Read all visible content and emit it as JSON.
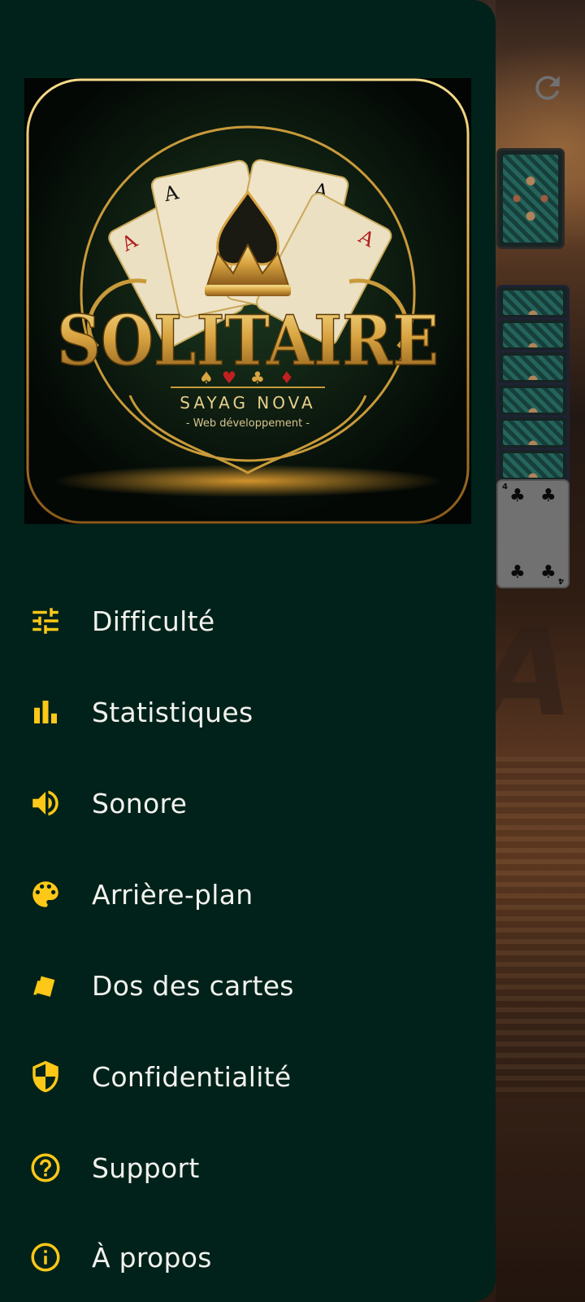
{
  "logo": {
    "title": "SOLITAIRE",
    "developer": "SAYAG NOVA",
    "tagline": "- Web développement -",
    "card_ranks": [
      "A",
      "A",
      "A",
      "A"
    ]
  },
  "menu": {
    "items": [
      {
        "label": "Difficulté",
        "icon": "tune-sliders-icon"
      },
      {
        "label": "Statistiques",
        "icon": "bar-chart-icon"
      },
      {
        "label": "Sonore",
        "icon": "volume-icon"
      },
      {
        "label": "Arrière-plan",
        "icon": "palette-icon"
      },
      {
        "label": "Dos des cartes",
        "icon": "cards-icon"
      },
      {
        "label": "Confidentialité",
        "icon": "shield-icon"
      },
      {
        "label": "Support",
        "icon": "help-circle-icon"
      },
      {
        "label": "À propos",
        "icon": "info-circle-icon"
      }
    ]
  },
  "game": {
    "face_up_card": {
      "rank": "4",
      "suit": "♣"
    },
    "suit_symbols": [
      "♠",
      "♥",
      "♣",
      "♦"
    ]
  },
  "colors": {
    "drawer_bg": "#00221a",
    "icon_accent": "#fdc817",
    "label_text": "#f2f2ee",
    "gold": "#d9a441"
  }
}
